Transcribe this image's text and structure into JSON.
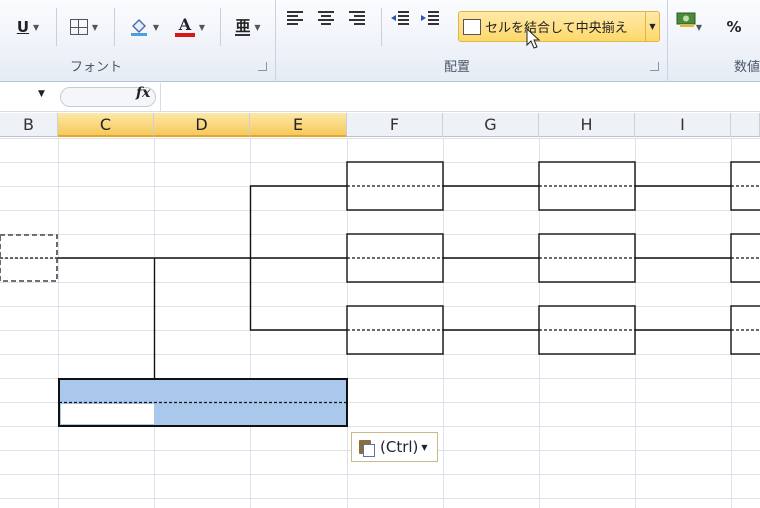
{
  "ribbon": {
    "groups": {
      "font_label": "フォント",
      "align_label": "配置",
      "number_label": "数値"
    },
    "merge_button_label": "セルを結合して中央揃え",
    "percent_label": "%",
    "underline_label": "U",
    "font_color_label": "A"
  },
  "formula_bar": {
    "fx_label": "fx",
    "value": ""
  },
  "columns": [
    "B",
    "C",
    "D",
    "E",
    "F",
    "G",
    "H",
    "I"
  ],
  "selected_columns": [
    "C",
    "D",
    "E"
  ],
  "paste_options": {
    "label": "(Ctrl)"
  },
  "colors": {
    "selection": "#a9c8ec",
    "selected_header": "#f7c95a",
    "gridline": "#dde2ea"
  }
}
